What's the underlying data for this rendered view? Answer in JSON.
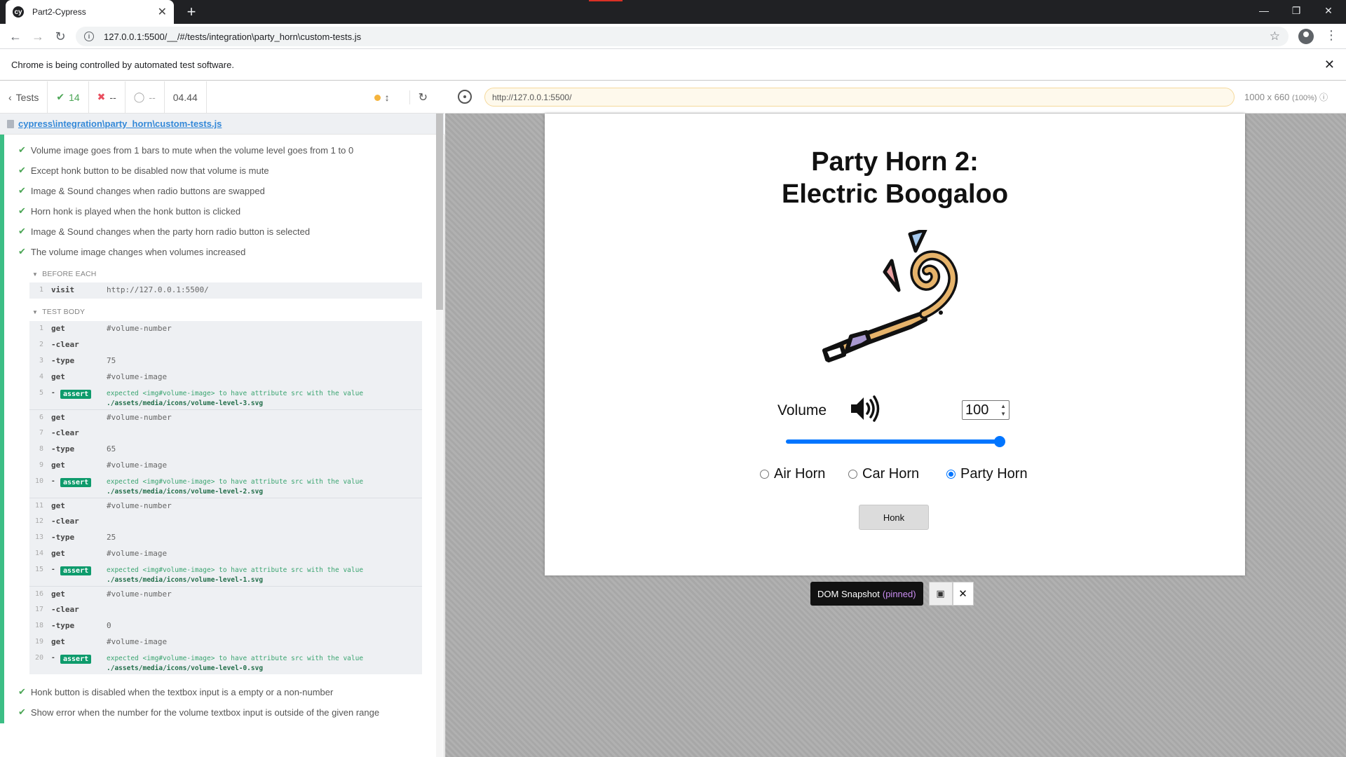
{
  "browser": {
    "tab_title": "Part2-Cypress",
    "favicon_text": "cy",
    "new_tab": "+",
    "url": "127.0.0.1:5500/__/#/tests/integration\\party_horn\\custom-tests.js",
    "infobar_text": "Chrome is being controlled by automated test software."
  },
  "reporter": {
    "tests_label": "Tests",
    "passed_count": "14",
    "failed_count": "--",
    "pending_count": "--",
    "duration": "04.44",
    "spec_path": "cypress\\integration\\party_horn\\custom-tests.js",
    "tests_top": [
      "Volume image goes from 1 bars to mute when the volume level goes from 1 to 0",
      "Except honk button to be disabled now that volume is mute",
      "Image & Sound changes when radio buttons are swapped",
      "Horn honk is played when the honk button is clicked",
      "Image & Sound changes when the party horn radio button is selected",
      "The volume image changes when volumes increased"
    ],
    "before_each_label": "BEFORE EACH",
    "before_each": {
      "num": "1",
      "cmd": "visit",
      "msg": "http://127.0.0.1:5500/"
    },
    "test_body_label": "TEST BODY",
    "commands": [
      {
        "num": "1",
        "cmd": "get",
        "msg": "#volume-number"
      },
      {
        "num": "2",
        "cmd": "-clear",
        "msg": ""
      },
      {
        "num": "3",
        "cmd": "-type",
        "msg": "75"
      },
      {
        "num": "4",
        "cmd": "get",
        "msg": "#volume-image"
      },
      {
        "num": "5",
        "assert_label": "assert",
        "line1": "expected <img#volume-image> to have attribute src with the value",
        "line2": "./assets/media/icons/volume-level-3.svg"
      },
      {
        "num": "6",
        "cmd": "get",
        "msg": "#volume-number"
      },
      {
        "num": "7",
        "cmd": "-clear",
        "msg": ""
      },
      {
        "num": "8",
        "cmd": "-type",
        "msg": "65"
      },
      {
        "num": "9",
        "cmd": "get",
        "msg": "#volume-image"
      },
      {
        "num": "10",
        "assert_label": "assert",
        "line1": "expected <img#volume-image> to have attribute src with the value",
        "line2": "./assets/media/icons/volume-level-2.svg"
      },
      {
        "num": "11",
        "cmd": "get",
        "msg": "#volume-number"
      },
      {
        "num": "12",
        "cmd": "-clear",
        "msg": ""
      },
      {
        "num": "13",
        "cmd": "-type",
        "msg": "25"
      },
      {
        "num": "14",
        "cmd": "get",
        "msg": "#volume-image"
      },
      {
        "num": "15",
        "assert_label": "assert",
        "line1": "expected <img#volume-image> to have attribute src with the value",
        "line2": "./assets/media/icons/volume-level-1.svg"
      },
      {
        "num": "16",
        "cmd": "get",
        "msg": "#volume-number"
      },
      {
        "num": "17",
        "cmd": "-clear",
        "msg": ""
      },
      {
        "num": "18",
        "cmd": "-type",
        "msg": "0"
      },
      {
        "num": "19",
        "cmd": "get",
        "msg": "#volume-image"
      },
      {
        "num": "20",
        "assert_label": "assert",
        "line1": "expected <img#volume-image> to have attribute src with the value",
        "line2": "./assets/media/icons/volume-level-0.svg"
      }
    ],
    "tests_bottom": [
      "Honk button is disabled when the textbox input is a empty or a non-number",
      "Show error when the number for the volume textbox input is outside of the given range"
    ]
  },
  "aut": {
    "url": "http://127.0.0.1:5500/",
    "viewport": "1000 x 660",
    "zoom": "(100%)"
  },
  "app": {
    "title_line1": "Party Horn 2:",
    "title_line2": "Electric Boogaloo",
    "volume_label": "Volume",
    "volume_value": "100",
    "slider_level": 1.0,
    "radios": [
      {
        "label": "Air Horn",
        "checked": false
      },
      {
        "label": "Car Horn",
        "checked": false
      },
      {
        "label": "Party Horn",
        "checked": true
      }
    ],
    "honk_label": "Honk"
  },
  "snapshot": {
    "label": "DOM Snapshot",
    "pinned": "(pinned)"
  },
  "colors": {
    "pass": "#4ca656",
    "fail": "#e94f5f",
    "accent": "#0075ff",
    "assert_badge": "#0e9b6c"
  }
}
